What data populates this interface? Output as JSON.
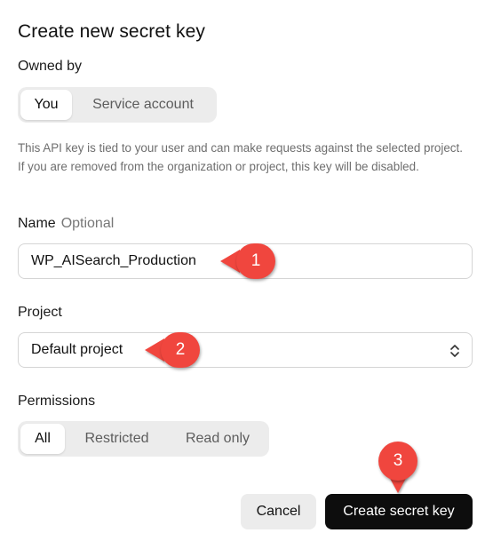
{
  "dialog": {
    "title": "Create new secret key"
  },
  "owned_by": {
    "label": "Owned by",
    "options": [
      "You",
      "Service account"
    ],
    "selected": "You"
  },
  "description": "This API key is tied to your user and can make requests against the selected project. If you are removed from the organization or project, this key will be disabled.",
  "name_field": {
    "label": "Name",
    "optional_label": "Optional",
    "value": "WP_AISearch_Production"
  },
  "project_field": {
    "label": "Project",
    "value": "Default project",
    "icon": "chevron-up-down-icon"
  },
  "permissions": {
    "label": "Permissions",
    "options": [
      "All",
      "Restricted",
      "Read only"
    ],
    "selected": "All"
  },
  "callouts": [
    "1",
    "2",
    "3"
  ],
  "buttons": {
    "cancel": "Cancel",
    "create": "Create secret key"
  },
  "colors": {
    "callout": "#f0463e",
    "primary_button": "#0d0d0d",
    "segment_bg": "#ececec"
  }
}
